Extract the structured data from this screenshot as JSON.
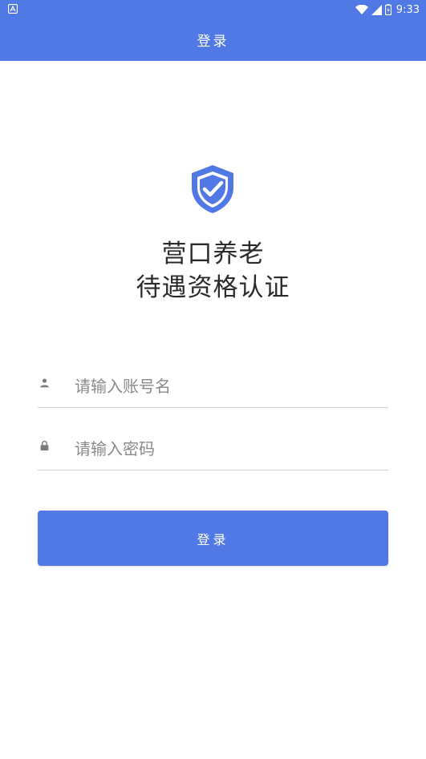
{
  "status_bar": {
    "time": "9:33",
    "icons": [
      "notification-icon",
      "wifi-icon",
      "signal-icon",
      "battery-icon"
    ]
  },
  "header": {
    "title": "登录"
  },
  "brand": {
    "line1": "营口养老",
    "line2": "待遇资格认证",
    "logo_icon": "shield-check-icon"
  },
  "form": {
    "username": {
      "placeholder": "请输入账号名",
      "value": "",
      "icon": "person-icon"
    },
    "password": {
      "placeholder": "请输入密码",
      "value": "",
      "icon": "lock-icon"
    },
    "submit_label": "登录"
  },
  "colors": {
    "primary": "#5079e6",
    "text_dark": "#2a2a2a",
    "placeholder": "#8a8a8a",
    "divider": "#cfcfcf"
  }
}
